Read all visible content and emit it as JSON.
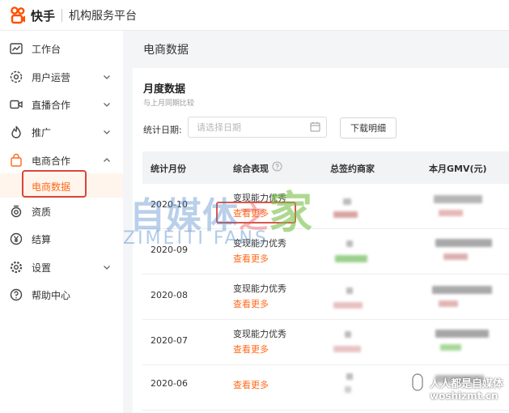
{
  "header": {
    "logo_text": "快手",
    "platform_title": "机构服务平台"
  },
  "sidebar": {
    "items": [
      {
        "label": "工作台",
        "icon": "chart-line-icon",
        "has_chevron": false
      },
      {
        "label": "用户运营",
        "icon": "user-gear-icon",
        "has_chevron": true,
        "chevron": "down"
      },
      {
        "label": "直播合作",
        "icon": "video-camera-icon",
        "has_chevron": true,
        "chevron": "down"
      },
      {
        "label": "推广",
        "icon": "flame-icon",
        "has_chevron": true,
        "chevron": "down"
      },
      {
        "label": "电商合作",
        "icon": "shopping-bag-icon",
        "has_chevron": true,
        "chevron": "up"
      },
      {
        "label": "资质",
        "icon": "badge-icon",
        "has_chevron": false
      },
      {
        "label": "结算",
        "icon": "yen-icon",
        "has_chevron": false
      },
      {
        "label": "设置",
        "icon": "gear-icon",
        "has_chevron": true,
        "chevron": "down"
      },
      {
        "label": "帮助中心",
        "icon": "question-circle-icon",
        "has_chevron": false
      }
    ],
    "active_sub": "电商数据"
  },
  "page": {
    "title": "电商数据"
  },
  "card": {
    "title": "月度数据",
    "subtitle": "与上月同期比较",
    "date_label": "统计日期:",
    "date_placeholder": "请选择日期",
    "download_label": "下载明细"
  },
  "table": {
    "headers": [
      "统计月份",
      "综合表现",
      "总签约商家",
      "本月GMV(元)"
    ],
    "rows": [
      {
        "month": "2020-10",
        "perf": "变现能力优秀",
        "link": "查看更多"
      },
      {
        "month": "2020-09",
        "perf": "变现能力优秀",
        "link": "查看更多"
      },
      {
        "month": "2020-08",
        "perf": "变现能力优秀",
        "link": "查看更多"
      },
      {
        "month": "2020-07",
        "perf": "变现能力优秀",
        "link": "查看更多"
      },
      {
        "month": "2020-06",
        "perf": "",
        "link": "查看更多"
      }
    ]
  },
  "watermarks": {
    "brand_cn_1": "自媒体",
    "brand_cn_2": "之",
    "brand_cn_3": "家",
    "brand_en": "ZIMEITI FANS",
    "site_title": "人人都是自媒体",
    "site_url": "woshizmt.cn"
  },
  "colors": {
    "accent": "#ff6a1a",
    "highlight_box": "#d8453a",
    "active_bg": "#fff5ec"
  }
}
